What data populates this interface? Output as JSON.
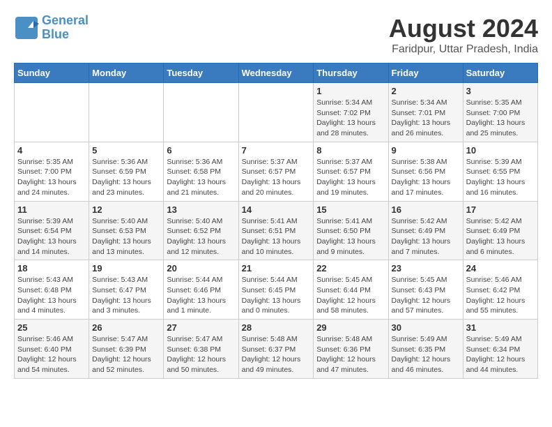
{
  "header": {
    "logo_line1": "General",
    "logo_line2": "Blue",
    "month_year": "August 2024",
    "location": "Faridpur, Uttar Pradesh, India"
  },
  "weekdays": [
    "Sunday",
    "Monday",
    "Tuesday",
    "Wednesday",
    "Thursday",
    "Friday",
    "Saturday"
  ],
  "weeks": [
    [
      {
        "day": "",
        "info": ""
      },
      {
        "day": "",
        "info": ""
      },
      {
        "day": "",
        "info": ""
      },
      {
        "day": "",
        "info": ""
      },
      {
        "day": "1",
        "info": "Sunrise: 5:34 AM\nSunset: 7:02 PM\nDaylight: 13 hours and 28 minutes."
      },
      {
        "day": "2",
        "info": "Sunrise: 5:34 AM\nSunset: 7:01 PM\nDaylight: 13 hours and 26 minutes."
      },
      {
        "day": "3",
        "info": "Sunrise: 5:35 AM\nSunset: 7:00 PM\nDaylight: 13 hours and 25 minutes."
      }
    ],
    [
      {
        "day": "4",
        "info": "Sunrise: 5:35 AM\nSunset: 7:00 PM\nDaylight: 13 hours and 24 minutes."
      },
      {
        "day": "5",
        "info": "Sunrise: 5:36 AM\nSunset: 6:59 PM\nDaylight: 13 hours and 23 minutes."
      },
      {
        "day": "6",
        "info": "Sunrise: 5:36 AM\nSunset: 6:58 PM\nDaylight: 13 hours and 21 minutes."
      },
      {
        "day": "7",
        "info": "Sunrise: 5:37 AM\nSunset: 6:57 PM\nDaylight: 13 hours and 20 minutes."
      },
      {
        "day": "8",
        "info": "Sunrise: 5:37 AM\nSunset: 6:57 PM\nDaylight: 13 hours and 19 minutes."
      },
      {
        "day": "9",
        "info": "Sunrise: 5:38 AM\nSunset: 6:56 PM\nDaylight: 13 hours and 17 minutes."
      },
      {
        "day": "10",
        "info": "Sunrise: 5:39 AM\nSunset: 6:55 PM\nDaylight: 13 hours and 16 minutes."
      }
    ],
    [
      {
        "day": "11",
        "info": "Sunrise: 5:39 AM\nSunset: 6:54 PM\nDaylight: 13 hours and 14 minutes."
      },
      {
        "day": "12",
        "info": "Sunrise: 5:40 AM\nSunset: 6:53 PM\nDaylight: 13 hours and 13 minutes."
      },
      {
        "day": "13",
        "info": "Sunrise: 5:40 AM\nSunset: 6:52 PM\nDaylight: 13 hours and 12 minutes."
      },
      {
        "day": "14",
        "info": "Sunrise: 5:41 AM\nSunset: 6:51 PM\nDaylight: 13 hours and 10 minutes."
      },
      {
        "day": "15",
        "info": "Sunrise: 5:41 AM\nSunset: 6:50 PM\nDaylight: 13 hours and 9 minutes."
      },
      {
        "day": "16",
        "info": "Sunrise: 5:42 AM\nSunset: 6:49 PM\nDaylight: 13 hours and 7 minutes."
      },
      {
        "day": "17",
        "info": "Sunrise: 5:42 AM\nSunset: 6:49 PM\nDaylight: 13 hours and 6 minutes."
      }
    ],
    [
      {
        "day": "18",
        "info": "Sunrise: 5:43 AM\nSunset: 6:48 PM\nDaylight: 13 hours and 4 minutes."
      },
      {
        "day": "19",
        "info": "Sunrise: 5:43 AM\nSunset: 6:47 PM\nDaylight: 13 hours and 3 minutes."
      },
      {
        "day": "20",
        "info": "Sunrise: 5:44 AM\nSunset: 6:46 PM\nDaylight: 13 hours and 1 minute."
      },
      {
        "day": "21",
        "info": "Sunrise: 5:44 AM\nSunset: 6:45 PM\nDaylight: 13 hours and 0 minutes."
      },
      {
        "day": "22",
        "info": "Sunrise: 5:45 AM\nSunset: 6:44 PM\nDaylight: 12 hours and 58 minutes."
      },
      {
        "day": "23",
        "info": "Sunrise: 5:45 AM\nSunset: 6:43 PM\nDaylight: 12 hours and 57 minutes."
      },
      {
        "day": "24",
        "info": "Sunrise: 5:46 AM\nSunset: 6:42 PM\nDaylight: 12 hours and 55 minutes."
      }
    ],
    [
      {
        "day": "25",
        "info": "Sunrise: 5:46 AM\nSunset: 6:40 PM\nDaylight: 12 hours and 54 minutes."
      },
      {
        "day": "26",
        "info": "Sunrise: 5:47 AM\nSunset: 6:39 PM\nDaylight: 12 hours and 52 minutes."
      },
      {
        "day": "27",
        "info": "Sunrise: 5:47 AM\nSunset: 6:38 PM\nDaylight: 12 hours and 50 minutes."
      },
      {
        "day": "28",
        "info": "Sunrise: 5:48 AM\nSunset: 6:37 PM\nDaylight: 12 hours and 49 minutes."
      },
      {
        "day": "29",
        "info": "Sunrise: 5:48 AM\nSunset: 6:36 PM\nDaylight: 12 hours and 47 minutes."
      },
      {
        "day": "30",
        "info": "Sunrise: 5:49 AM\nSunset: 6:35 PM\nDaylight: 12 hours and 46 minutes."
      },
      {
        "day": "31",
        "info": "Sunrise: 5:49 AM\nSunset: 6:34 PM\nDaylight: 12 hours and 44 minutes."
      }
    ]
  ]
}
